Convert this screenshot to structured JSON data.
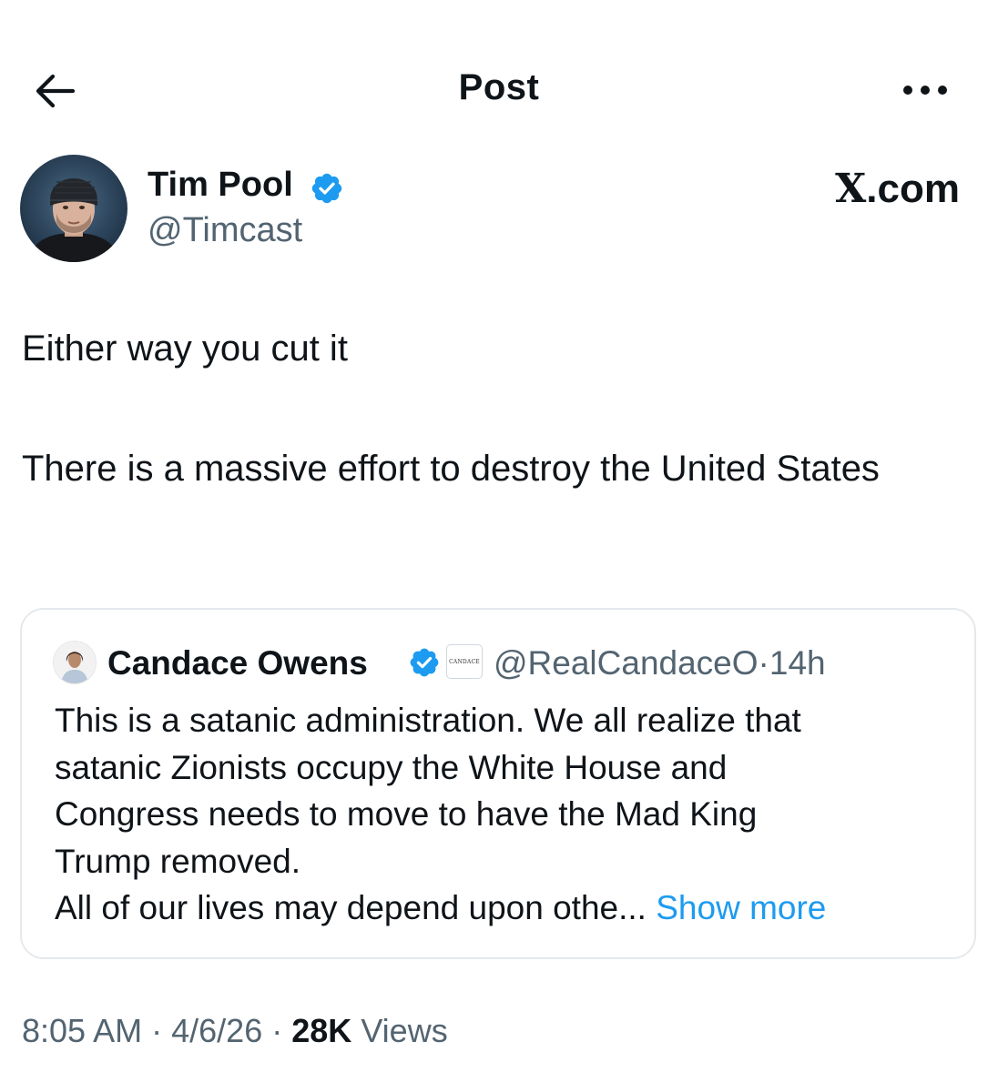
{
  "header": {
    "title": "Post",
    "back_icon": "arrow-left-icon",
    "more_icon": "ellipsis-icon"
  },
  "author": {
    "name": "Tim Pool",
    "handle": "@Timcast",
    "verified_icon": "verified-badge-icon",
    "verified_color": "#1d9bf0"
  },
  "brand": {
    "x": "X",
    "domain": ".com"
  },
  "post": {
    "paragraphs": [
      "Either way you cut it",
      "There is a massive effort to destroy the United States"
    ]
  },
  "quote": {
    "name": "Candace Owens",
    "affiliate_badge": "CANDACE",
    "handle": "@RealCandaceO",
    "separator": "·",
    "time": "14h",
    "lines": [
      "This is a satanic administration. We all realize that",
      "satanic Zionists occupy the White House and",
      "Congress needs to move to have the Mad King",
      "Trump removed.",
      "All of our lives may depend upon othe..."
    ],
    "show_more": "Show more",
    "link_color": "#1d9bf0"
  },
  "meta": {
    "time": "8:05 AM",
    "date": "4/6/26",
    "separator": "·",
    "views_count": "28K",
    "views_label": "Views"
  }
}
